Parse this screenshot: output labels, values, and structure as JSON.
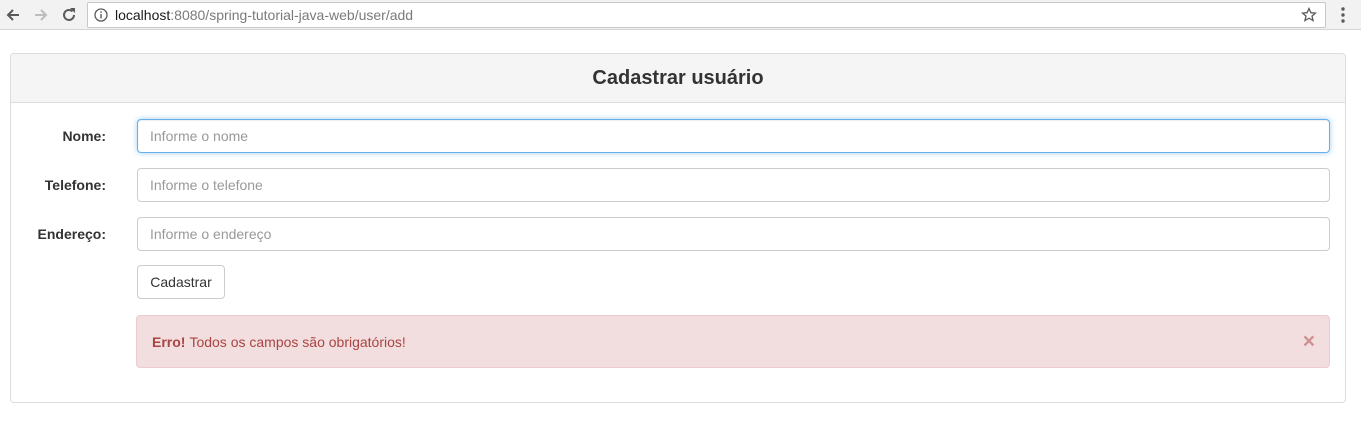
{
  "browser": {
    "url_host": "localhost",
    "url_rest": ":8080/spring-tutorial-java-web/user/add"
  },
  "panel": {
    "title": "Cadastrar usuário"
  },
  "form": {
    "fields": [
      {
        "label": "Nome:",
        "placeholder": "Informe o nome",
        "value": "",
        "focused": true
      },
      {
        "label": "Telefone:",
        "placeholder": "Informe o telefone",
        "value": ""
      },
      {
        "label": "Endereço:",
        "placeholder": "Informe o endereço",
        "value": ""
      }
    ],
    "submit_label": "Cadastrar"
  },
  "alert": {
    "title": "Erro!",
    "message": "Todos os campos são obrigatórios!",
    "close": "×"
  },
  "colors": {
    "alert_background": "#f2dede",
    "alert_text": "#a94442",
    "focus_border": "#66afe9"
  }
}
